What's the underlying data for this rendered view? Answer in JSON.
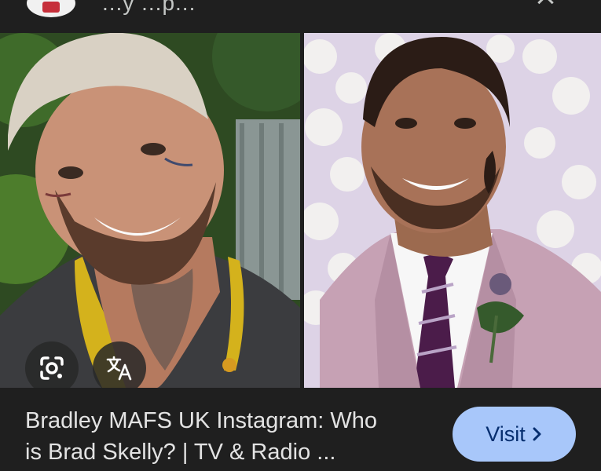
{
  "top_bar": {
    "site_name": "...y ...p...",
    "favicon_icon": "site-favicon",
    "more_icon": "more-vert-icon",
    "close_icon": "close-icon"
  },
  "images": {
    "left": {
      "icon": "photo"
    },
    "right": {
      "icon": "photo"
    }
  },
  "overlay_buttons": {
    "lens_icon": "google-lens-icon",
    "translate_icon": "translate-icon"
  },
  "result": {
    "title_line1": "Bradley MAFS UK Instagram: Who",
    "title_line2": "is Brad Skelly? | TV & Radio ..."
  },
  "visit_button": {
    "label": "Visit",
    "icon": "chevron-right-icon"
  },
  "colors": {
    "background": "#1f1f1f",
    "visit_button": "#a8c7fa",
    "visit_text": "#062e6f",
    "text": "#e3e3e3"
  }
}
